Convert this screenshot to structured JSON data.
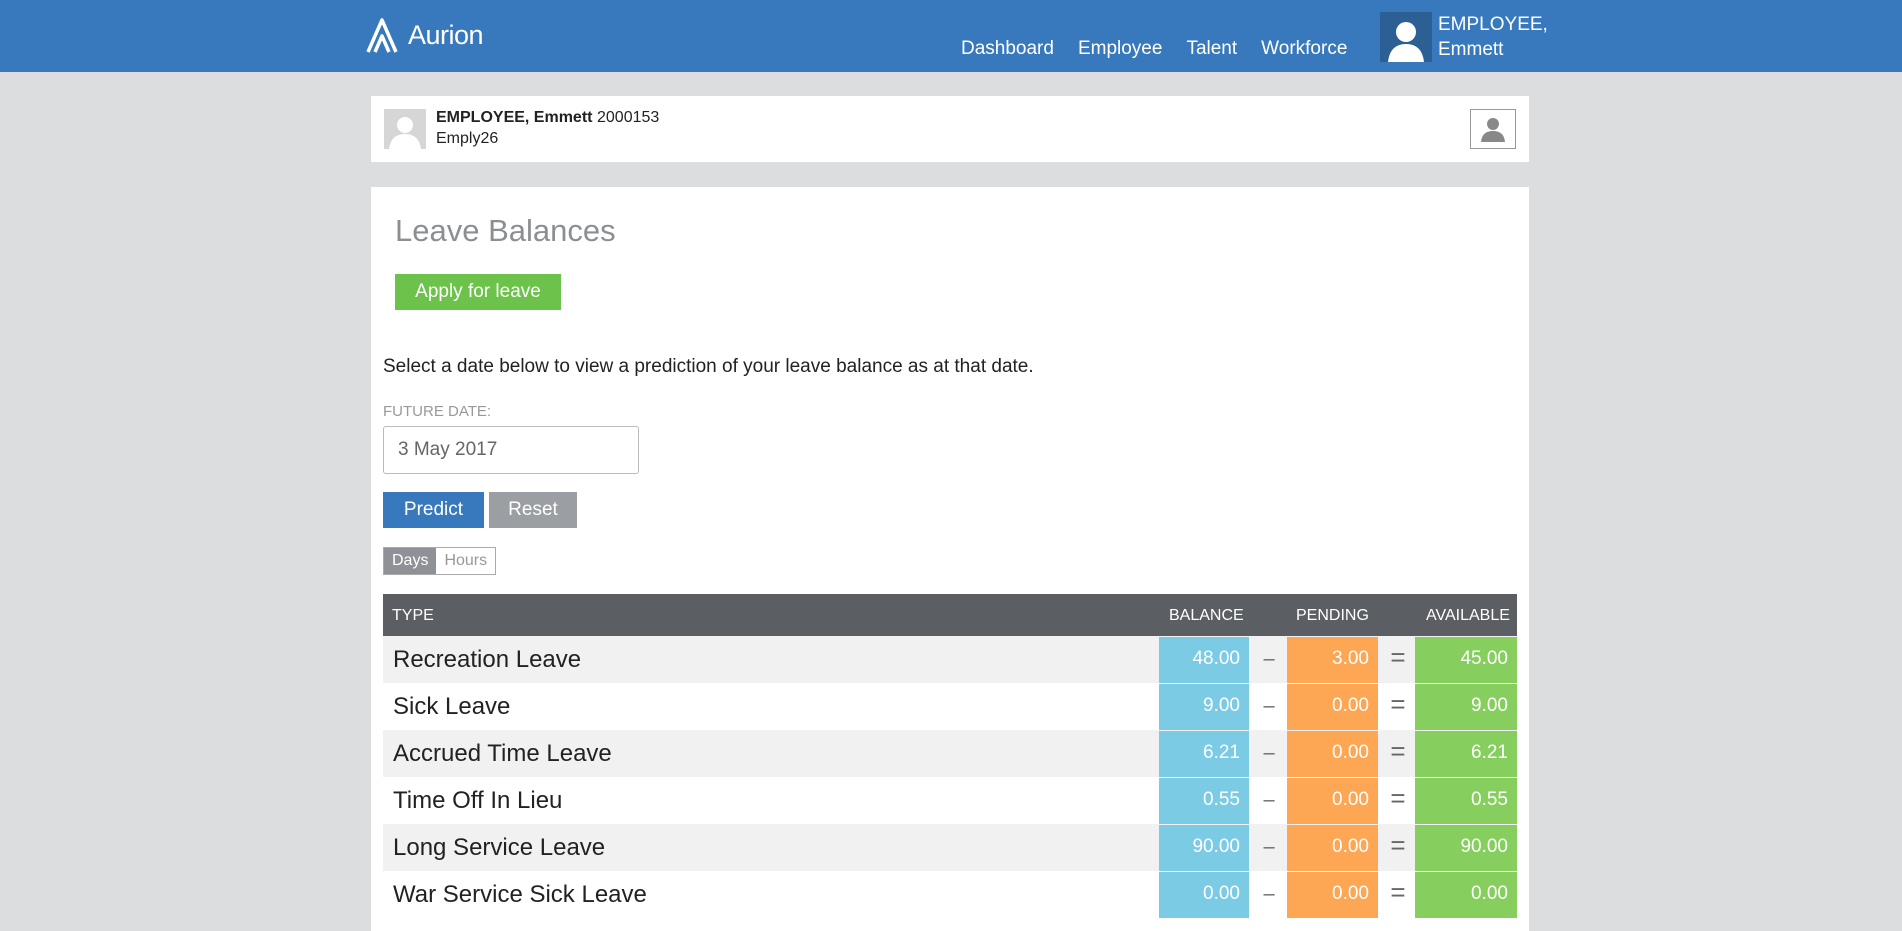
{
  "brand": {
    "name": "Aurion"
  },
  "nav": {
    "items": [
      "Dashboard",
      "Employee",
      "Talent",
      "Workforce"
    ]
  },
  "user": {
    "line1": "EMPLOYEE,",
    "line2": "Emmett"
  },
  "profile": {
    "name": "EMPLOYEE, Emmett",
    "id": "2000153",
    "username": "Emply26"
  },
  "page": {
    "title": "Leave Balances",
    "apply_label": "Apply for leave",
    "instructions": "Select a date below to view a prediction of your leave balance as at that date.",
    "future_date_label": "FUTURE DATE:",
    "future_date_value": "3 May 2017",
    "predict_label": "Predict",
    "reset_label": "Reset",
    "unit_toggle": {
      "days": "Days",
      "hours": "Hours",
      "selected": "Days"
    }
  },
  "table": {
    "headers": {
      "type": "TYPE",
      "balance": "BALANCE",
      "pending": "PENDING",
      "available": "AVAILABLE"
    },
    "minus_symbol": "–",
    "equals_symbol": "=",
    "rows": [
      {
        "type": "Recreation Leave",
        "balance": "48.00",
        "pending": "3.00",
        "available": "45.00"
      },
      {
        "type": "Sick Leave",
        "balance": "9.00",
        "pending": "0.00",
        "available": "9.00"
      },
      {
        "type": "Accrued Time Leave",
        "balance": "6.21",
        "pending": "0.00",
        "available": "6.21"
      },
      {
        "type": "Time Off In Lieu",
        "balance": "0.55",
        "pending": "0.00",
        "available": "0.55"
      },
      {
        "type": "Long Service Leave",
        "balance": "90.00",
        "pending": "0.00",
        "available": "90.00"
      },
      {
        "type": "War Service Sick Leave",
        "balance": "0.00",
        "pending": "0.00",
        "available": "0.00"
      }
    ]
  },
  "colors": {
    "header_bg": "#3779bc",
    "balance": "#7ccbe4",
    "pending": "#fda654",
    "available": "#86cf5f",
    "apply": "#6cc24a"
  }
}
